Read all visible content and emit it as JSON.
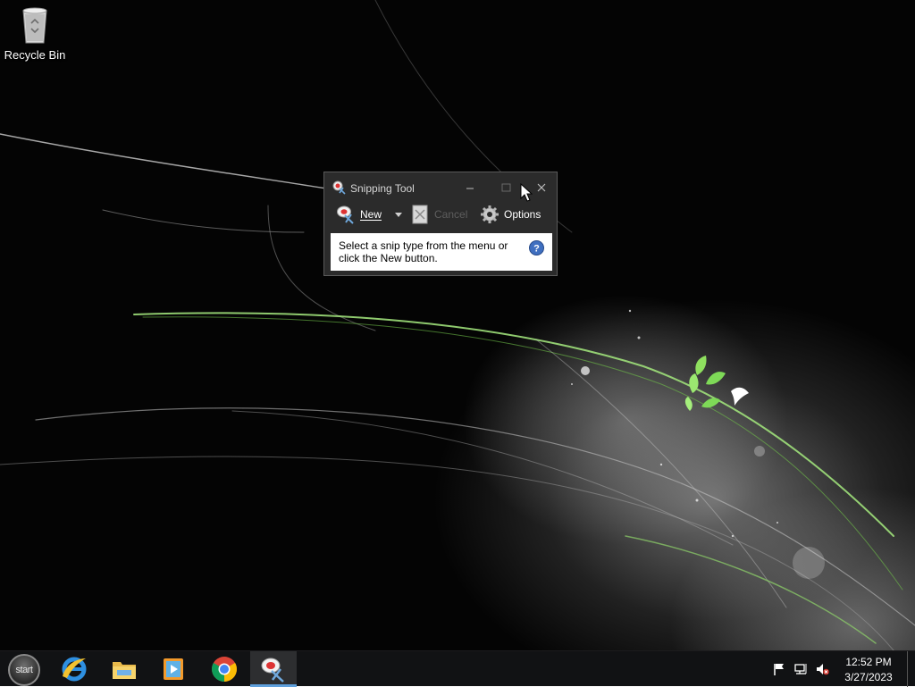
{
  "desktop": {
    "icons": [
      {
        "label": "Recycle Bin",
        "icon": "recycle-bin-icon"
      }
    ]
  },
  "snipping_tool": {
    "title": "Snipping Tool",
    "toolbar": {
      "new_label": "New",
      "cancel_label": "Cancel",
      "options_label": "Options"
    },
    "info_text": "Select a snip type from the menu or click the New button."
  },
  "taskbar": {
    "start_label": "start",
    "apps": [
      {
        "name": "Internet Explorer",
        "icon": "internet-explorer-icon"
      },
      {
        "name": "File Explorer",
        "icon": "file-explorer-icon"
      },
      {
        "name": "Windows Media Player",
        "icon": "media-player-icon"
      },
      {
        "name": "Google Chrome",
        "icon": "chrome-icon"
      },
      {
        "name": "Snipping Tool",
        "icon": "snipping-tool-icon",
        "active": true
      }
    ],
    "tray": {
      "time": "12:52 PM",
      "date": "3/27/2023"
    }
  },
  "colors": {
    "accent": "#5fa0dc",
    "window_bg": "#2b2b2b",
    "taskbar_bg": "#111214",
    "leaf_green": "#7ed957"
  }
}
